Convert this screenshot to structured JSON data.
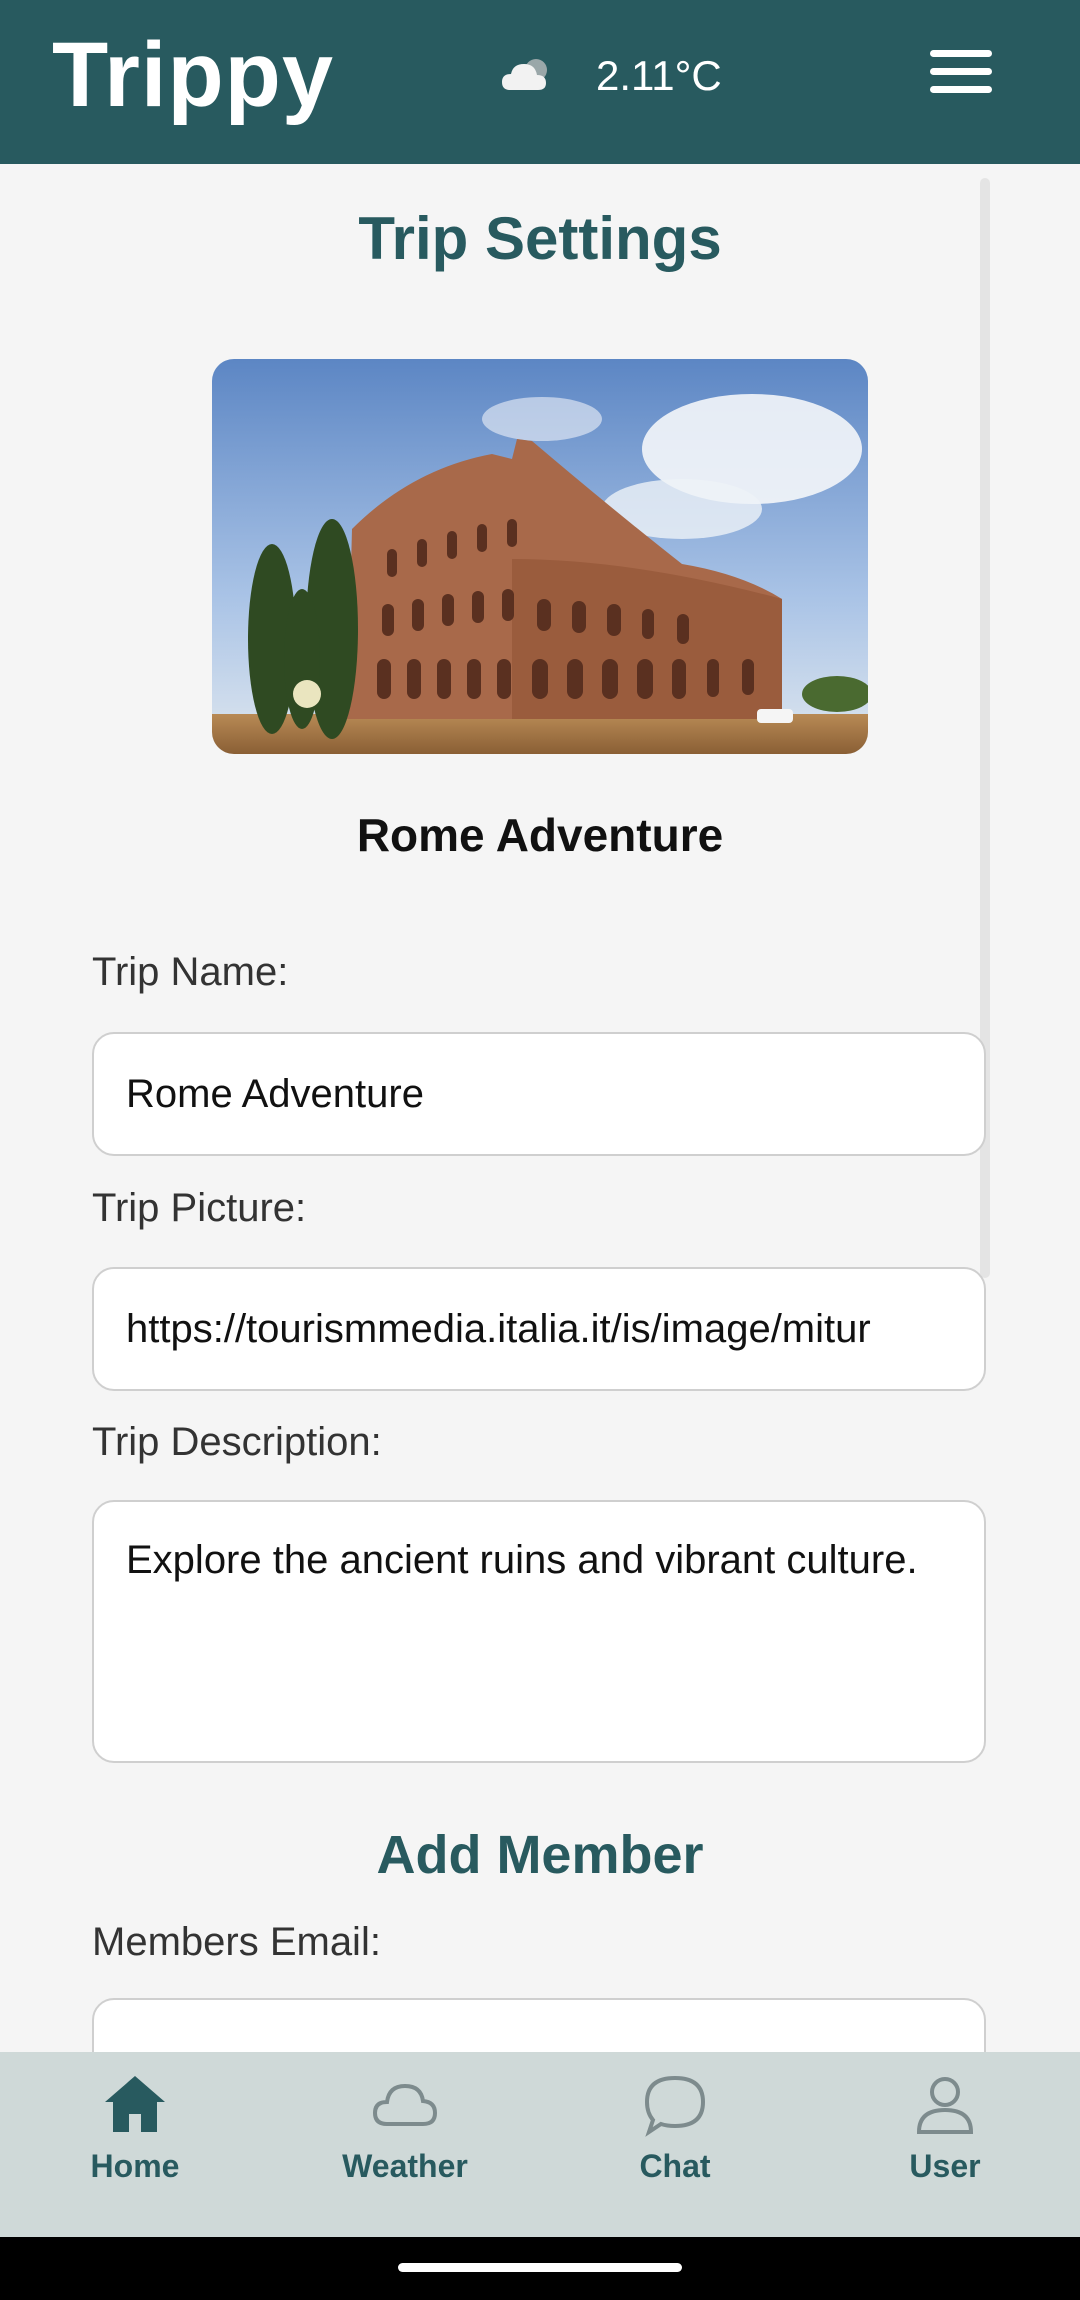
{
  "header": {
    "app_name": "Trippy",
    "weather_icon": "partly-cloudy-icon",
    "temperature": "2.11°C",
    "menu_icon": "hamburger-menu-icon"
  },
  "page": {
    "title": "Trip Settings",
    "trip_name_display": "Rome Adventure",
    "hero_image": "colosseum-photo"
  },
  "form": {
    "trip_name_label": "Trip Name:",
    "trip_name_value": "Rome Adventure",
    "trip_picture_label": "Trip Picture:",
    "trip_picture_value": "https://tourismmedia.italia.it/is/image/mitur",
    "trip_description_label": "Trip Description:",
    "trip_description_value": "Explore the ancient ruins and vibrant culture.",
    "add_member_title": "Add Member",
    "members_email_label": "Members Email:",
    "members_email_value": ""
  },
  "bottom_nav": {
    "items": [
      {
        "label": "Home",
        "icon": "home-icon"
      },
      {
        "label": "Weather",
        "icon": "cloud-icon"
      },
      {
        "label": "Chat",
        "icon": "chat-bubble-icon"
      },
      {
        "label": "User",
        "icon": "user-icon"
      }
    ]
  },
  "colors": {
    "primary": "#285a5f",
    "background": "#f5f5f5",
    "nav_background": "#cfd9d8"
  }
}
